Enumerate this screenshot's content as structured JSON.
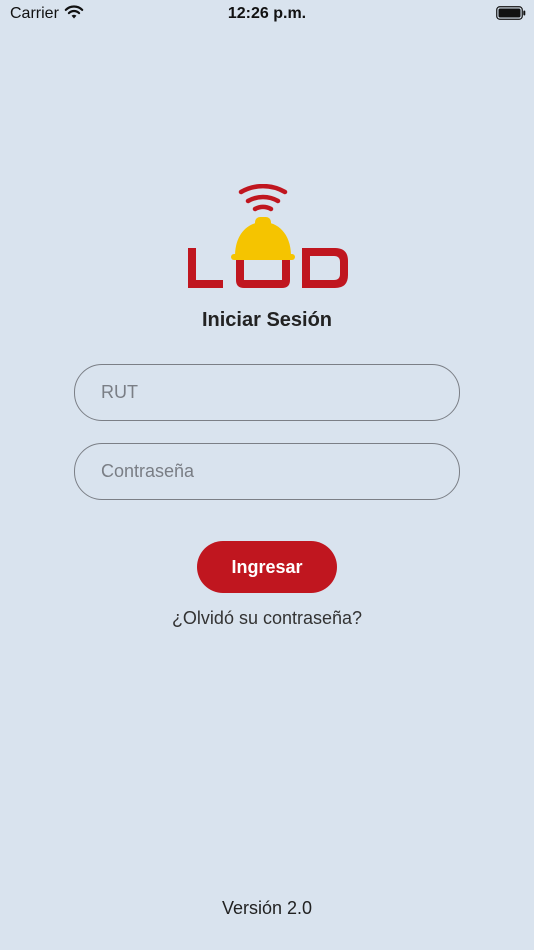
{
  "status_bar": {
    "carrier": "Carrier",
    "time": "12:26 p.m.",
    "wifi_icon": "wifi-icon",
    "battery_icon": "battery-icon"
  },
  "brand": {
    "red": "#c0161f",
    "yellow": "#f5c400",
    "background": "#d9e3ee"
  },
  "login": {
    "title": "Iniciar Sesión",
    "rut_placeholder": "RUT",
    "password_placeholder": "Contraseña",
    "submit_label": "Ingresar",
    "forgot_label": "¿Olvidó su contraseña?"
  },
  "footer": {
    "version": "Versión 2.0"
  }
}
